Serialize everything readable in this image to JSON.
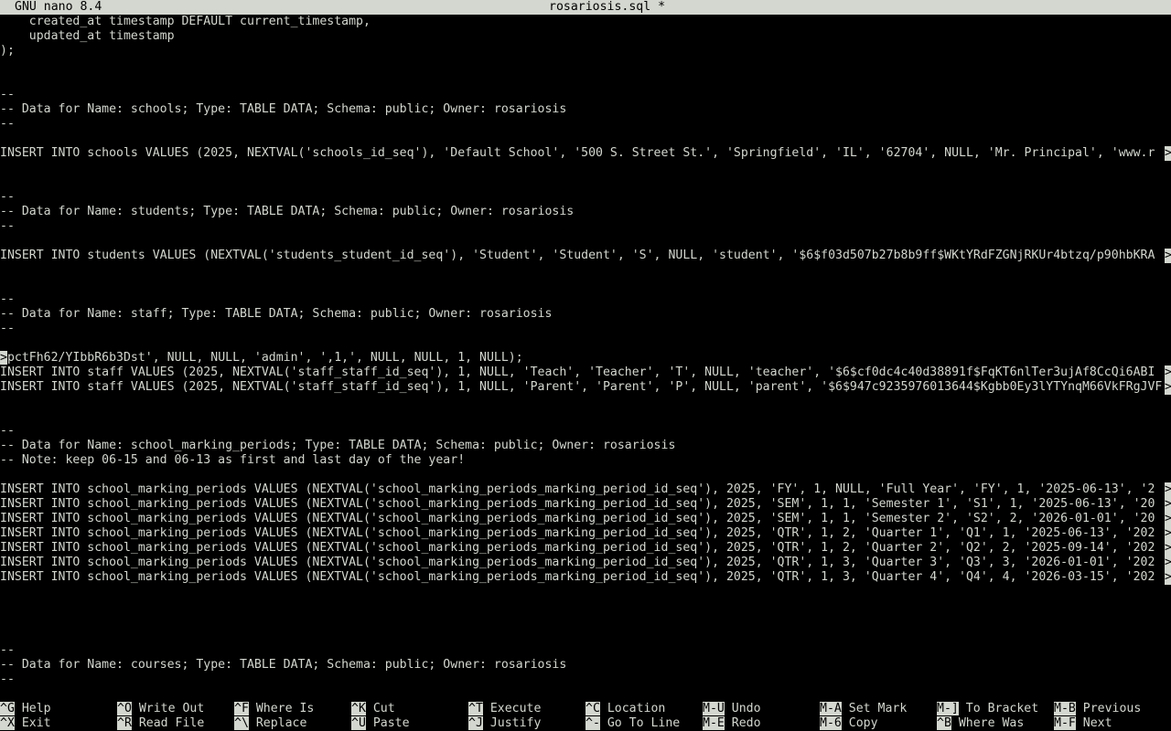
{
  "titlebar": {
    "version": "GNU nano 8.4",
    "filename": "rosariosis.sql *"
  },
  "editor": {
    "lines": [
      "    created_at timestamp DEFAULT current_timestamp,",
      "    updated_at timestamp",
      ");",
      "",
      "",
      "--",
      "-- Data for Name: schools; Type: TABLE DATA; Schema: public; Owner: rosariosis",
      "--",
      "",
      "INSERT INTO schools VALUES (2025, NEXTVAL('schools_id_seq'), 'Default School', '500 S. Street St.', 'Springfield', 'IL', '62704', NULL, 'Mr. Principal', 'www.r",
      "",
      "",
      "--",
      "-- Data for Name: students; Type: TABLE DATA; Schema: public; Owner: rosariosis",
      "--",
      "",
      "INSERT INTO students VALUES (NEXTVAL('students_student_id_seq'), 'Student', 'Student', 'S', NULL, 'student', '$6$f03d507b27b8b9ff$WKtYRdFZGNjRKUr4btzq/p90hbKRA",
      "",
      "",
      "--",
      "-- Data for Name: staff; Type: TABLE DATA; Schema: public; Owner: rosariosis",
      "--",
      "",
      "pctFh62/YIbbR6b3Dst', NULL, NULL, 'admin', ',1,', NULL, NULL, 1, NULL);",
      "INSERT INTO staff VALUES (2025, NEXTVAL('staff_staff_id_seq'), 1, NULL, 'Teach', 'Teacher', 'T', NULL, 'teacher', '$6$cf0dc4c40d38891f$FqKT6nlTer3ujAf8CcQi6ABI",
      "INSERT INTO staff VALUES (2025, NEXTVAL('staff_staff_id_seq'), 1, NULL, 'Parent', 'Parent', 'P', NULL, 'parent', '$6$947c9235976013644$Kgbb0Ey3lYTYnqM66VkFRgJVF",
      "",
      "",
      "--",
      "-- Data for Name: school_marking_periods; Type: TABLE DATA; Schema: public; Owner: rosariosis",
      "-- Note: keep 06-15 and 06-13 as first and last day of the year!",
      "",
      "INSERT INTO school_marking_periods VALUES (NEXTVAL('school_marking_periods_marking_period_id_seq'), 2025, 'FY', 1, NULL, 'Full Year', 'FY', 1, '2025-06-13', '2",
      "INSERT INTO school_marking_periods VALUES (NEXTVAL('school_marking_periods_marking_period_id_seq'), 2025, 'SEM', 1, 1, 'Semester 1', 'S1', 1, '2025-06-13', '20",
      "INSERT INTO school_marking_periods VALUES (NEXTVAL('school_marking_periods_marking_period_id_seq'), 2025, 'SEM', 1, 1, 'Semester 2', 'S2', 2, '2026-01-01', '20",
      "INSERT INTO school_marking_periods VALUES (NEXTVAL('school_marking_periods_marking_period_id_seq'), 2025, 'QTR', 1, 2, 'Quarter 1', 'Q1', 1, '2025-06-13', '202",
      "INSERT INTO school_marking_periods VALUES (NEXTVAL('school_marking_periods_marking_period_id_seq'), 2025, 'QTR', 1, 2, 'Quarter 2', 'Q2', 2, '2025-09-14', '202",
      "INSERT INTO school_marking_periods VALUES (NEXTVAL('school_marking_periods_marking_period_id_seq'), 2025, 'QTR', 1, 3, 'Quarter 3', 'Q3', 3, '2026-01-01', '202",
      "INSERT INTO school_marking_periods VALUES (NEXTVAL('school_marking_periods_marking_period_id_seq'), 2025, 'QTR', 1, 3, 'Quarter 4', 'Q4', 4, '2026-03-15', '202",
      "",
      "",
      "",
      "",
      "--",
      "-- Data for Name: courses; Type: TABLE DATA; Schema: public; Owner: rosariosis",
      "--",
      "",
      ""
    ],
    "overflow_lines": [
      9,
      16,
      24,
      25,
      32,
      33,
      34,
      35,
      36,
      37,
      38
    ],
    "cursor_line": 23,
    "overflow_marker": ">"
  },
  "shortcuts": [
    {
      "key": "^G",
      "label": "Help"
    },
    {
      "key": "^X",
      "label": "Exit"
    },
    {
      "key": "^O",
      "label": "Write Out"
    },
    {
      "key": "^R",
      "label": "Read File"
    },
    {
      "key": "^F",
      "label": "Where Is"
    },
    {
      "key": "^\\",
      "label": "Replace"
    },
    {
      "key": "^K",
      "label": "Cut"
    },
    {
      "key": "^U",
      "label": "Paste"
    },
    {
      "key": "^T",
      "label": "Execute"
    },
    {
      "key": "^J",
      "label": "Justify"
    },
    {
      "key": "^C",
      "label": "Location"
    },
    {
      "key": "^-",
      "label": "Go To Line"
    },
    {
      "key": "M-U",
      "label": "Undo"
    },
    {
      "key": "M-E",
      "label": "Redo"
    },
    {
      "key": "M-A",
      "label": "Set Mark"
    },
    {
      "key": "M-6",
      "label": "Copy"
    },
    {
      "key": "M-]",
      "label": "To Bracket"
    },
    {
      "key": "^B",
      "label": "Where Was"
    },
    {
      "key": "M-B",
      "label": "Previous"
    },
    {
      "key": "M-F",
      "label": "Next"
    }
  ]
}
